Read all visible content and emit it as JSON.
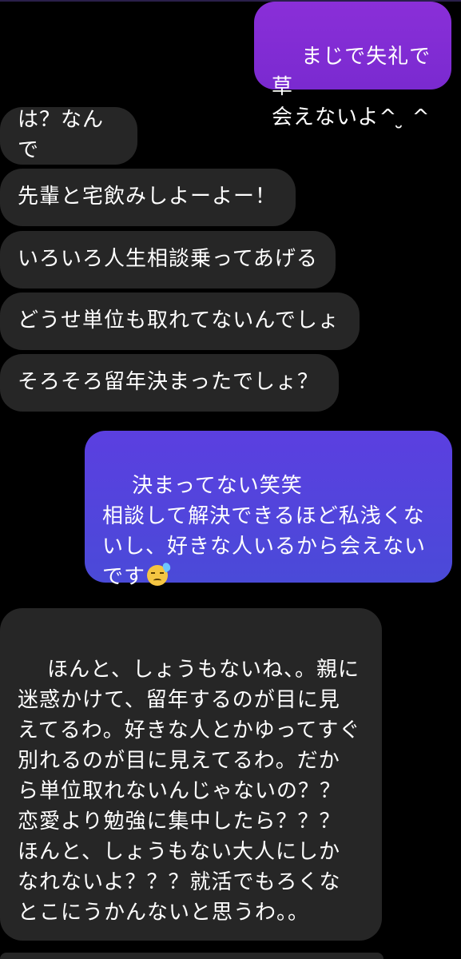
{
  "messages": [
    {
      "id": 0,
      "direction": "outgoing",
      "text": "まじで失礼で草\n会えないよ^ ̮ ^"
    },
    {
      "id": 1,
      "direction": "incoming",
      "text": "は？なんで"
    },
    {
      "id": 2,
      "direction": "incoming",
      "text": "先輩と宅飲みしよーよー！"
    },
    {
      "id": 3,
      "direction": "incoming",
      "text": "いろいろ人生相談乗ってあげる"
    },
    {
      "id": 4,
      "direction": "incoming",
      "text": "どうせ単位も取れてないんでしょ"
    },
    {
      "id": 5,
      "direction": "incoming",
      "text": "そろそろ留年決まったでしょ？"
    },
    {
      "id": 6,
      "direction": "outgoing",
      "text": "決まってない笑笑\n相談して解決できるほど私浅くな\nいし、好きな人いるから会えない\nです",
      "emoji": "downcast-face-with-sweat-icon"
    },
    {
      "id": 7,
      "direction": "incoming",
      "text": "ほんと、しょうもないね、。親に\n迷惑かけて、留年するのが目に見\nえてるわ。好きな人とかゆってすぐ\n別れるのが目に見えてるわ。だか\nら単位取れないんじゃないの？？\n恋愛より勉強に集中したら？？？\nほんと、しょうもない大人にしか\nなれないよ？？？就活でもろくな\nとこにうかんないと思うわ。。"
    }
  ],
  "colors": {
    "background": "#000000",
    "incoming_bubble": "#262626",
    "outgoing_top": "#8a2fd8",
    "outgoing_bottom": "#4a4ad8",
    "text": "#ffffff"
  }
}
